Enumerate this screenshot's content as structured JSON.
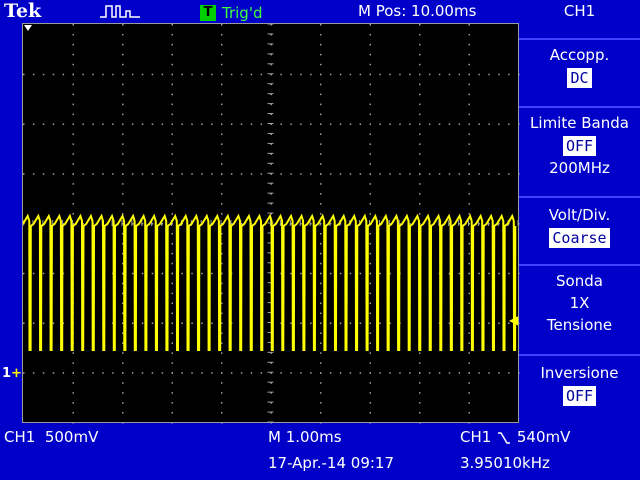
{
  "header": {
    "brand": "Tek",
    "acquisition_icon": "pulse-train-icon",
    "trigger_badge": "T",
    "trigger_status": "Trig'd",
    "main_position": "M Pos: 10.00ms"
  },
  "screen": {
    "channel_marker": "1",
    "trace_color": "#ffff00",
    "grid_divisions": {
      "horizontal": 10,
      "vertical": 8
    }
  },
  "menu": {
    "title": "CH1",
    "items": [
      {
        "label": "Accopp.",
        "value": "DC"
      },
      {
        "label": "Limite Banda",
        "value": "OFF",
        "sub": "200MHz"
      },
      {
        "label": "Volt/Div.",
        "value": "Coarse"
      },
      {
        "label": "Sonda",
        "line2": "1X",
        "line3": "Tensione"
      },
      {
        "label": "Inversione",
        "value": "OFF"
      }
    ]
  },
  "status": {
    "ch_scale": "CH1  500mV",
    "time_base": "M 1.00ms",
    "trigger_source": "CH1",
    "trigger_level": "540mV",
    "date_time": "17-Apr.-14 09:17",
    "frequency": "3.95010kHz"
  },
  "colors": {
    "background": "#0000c8",
    "trace": "#ffff00",
    "trigger_ok": "#40ff40"
  }
}
